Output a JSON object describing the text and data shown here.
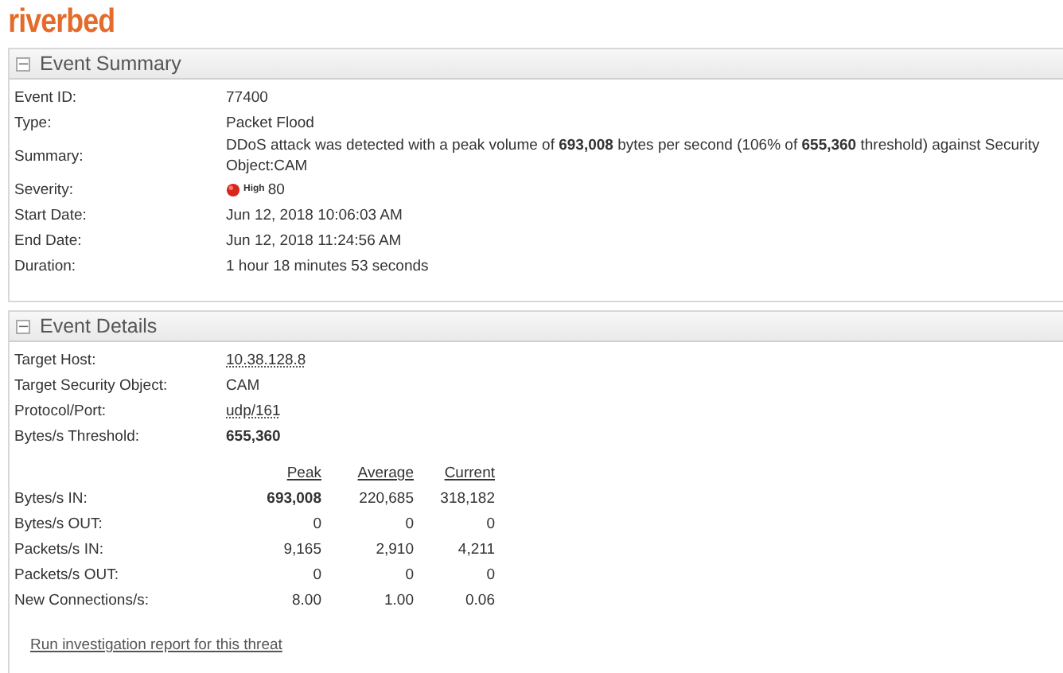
{
  "logo": "riverbed",
  "summary": {
    "title": "Event Summary",
    "toggle": "−",
    "fields": [
      {
        "kind": "text",
        "label": "Event ID:",
        "value": "77400"
      },
      {
        "kind": "text",
        "label": "Type:",
        "value": "Packet Flood"
      },
      {
        "kind": "rich",
        "label": "Summary:",
        "value": "DDoS attack was detected with a peak volume of **693,008** bytes per second (106% of **655,360** threshold) against Security Object:CAM"
      },
      {
        "kind": "severity",
        "label": "Severity:",
        "badge": "High",
        "value": "80"
      },
      {
        "kind": "text",
        "label": "Start Date:",
        "value": "Jun 12, 2018 10:06:03 AM"
      },
      {
        "kind": "text",
        "label": "End Date:",
        "value": "Jun 12, 2018 11:24:56 AM"
      },
      {
        "kind": "text",
        "label": "Duration:",
        "value": "1 hour 18 minutes 53 seconds"
      }
    ]
  },
  "details": {
    "title": "Event Details",
    "toggle": "−",
    "fields": [
      {
        "kind": "link",
        "label": "Target Host:",
        "value": "10.38.128.8"
      },
      {
        "kind": "text",
        "label": "Target Security Object:",
        "value": "CAM"
      },
      {
        "kind": "link",
        "label": "Protocol/Port:",
        "value": "udp/161"
      },
      {
        "kind": "bold",
        "label": "Bytes/s Threshold:",
        "value": "655,360"
      }
    ],
    "stats": {
      "columns": [
        "Peak",
        "Average",
        "Current"
      ],
      "rows": [
        {
          "label": "Bytes/s IN:",
          "highlight": true,
          "values": [
            "693,008",
            "220,685",
            "318,182"
          ]
        },
        {
          "label": "Bytes/s OUT:",
          "highlight": false,
          "values": [
            "0",
            "0",
            "0"
          ]
        },
        {
          "label": "Packets/s IN:",
          "highlight": false,
          "values": [
            "9,165",
            "2,910",
            "4,211"
          ]
        },
        {
          "label": "Packets/s OUT:",
          "highlight": false,
          "values": [
            "0",
            "0",
            "0"
          ]
        },
        {
          "label": "New Connections/s:",
          "highlight": false,
          "values": [
            "8.00",
            "1.00",
            "0.06"
          ]
        }
      ]
    },
    "report_link": "Run investigation report for this threat"
  }
}
